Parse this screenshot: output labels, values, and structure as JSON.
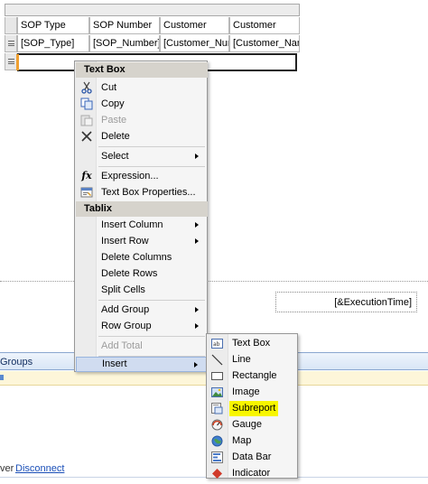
{
  "tablix": {
    "headers": [
      "SOP Type",
      "SOP Number",
      "Customer",
      "Customer"
    ],
    "row": [
      "[SOP_Type]",
      "[SOP_Number]",
      "[Customer_Num",
      "[Customer_Nam"
    ]
  },
  "execution_time_box": "[&ExecutionTime]",
  "groups_panel": {
    "label": "Groups"
  },
  "status": {
    "prefix": "ver",
    "link": "Disconnect"
  },
  "context_menu": {
    "header_textbox": "Text Box",
    "cut": "Cut",
    "copy": "Copy",
    "paste": "Paste",
    "delete": "Delete",
    "select": "Select",
    "expression": "Expression...",
    "textbox_properties": "Text Box Properties...",
    "header_tablix": "Tablix",
    "insert_column": "Insert Column",
    "insert_row": "Insert Row",
    "delete_columns": "Delete Columns",
    "delete_rows": "Delete Rows",
    "split_cells": "Split Cells",
    "add_group": "Add Group",
    "row_group": "Row Group",
    "add_total": "Add Total",
    "insert": "Insert"
  },
  "insert_submenu": {
    "items": [
      "Text Box",
      "Line",
      "Rectangle",
      "Image",
      "Subreport",
      "Gauge",
      "Map",
      "Data Bar",
      "Indicator"
    ],
    "highlighted": "Subreport",
    "highlight_color": "#f8f600"
  },
  "icons": {
    "cut": "scissors-icon",
    "copy": "copy-icon",
    "paste": "paste-icon",
    "delete": "delete-x-icon",
    "expression": "fx-icon",
    "properties": "properties-icon"
  },
  "colors": {
    "menu_hover": "#d0dcf0",
    "header_bg": "#d6d3cc",
    "link": "#1a4fb8"
  }
}
